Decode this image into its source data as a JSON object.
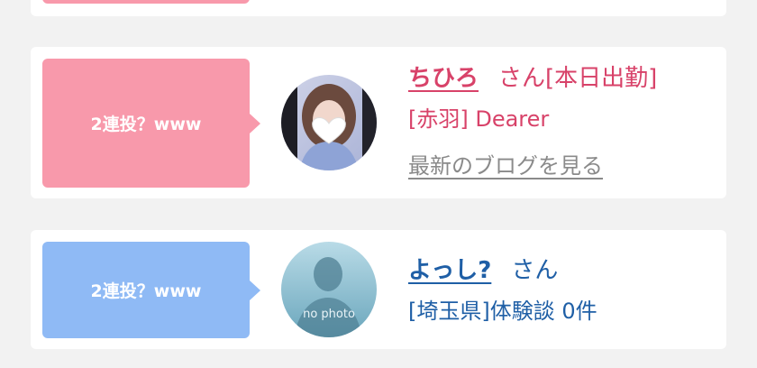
{
  "posts": [
    {
      "badge": "2連投？www",
      "name": "ちひろ",
      "honorific": "さん",
      "status": "[本日出勤]",
      "shop": "[赤羽] Dearer",
      "blog_link": "最新のブログを見る",
      "accent": "#d84269",
      "bubble_color": "#f899ab",
      "avatar_icon": "blurred-portrait-with-heart"
    },
    {
      "badge": "2連投？www",
      "name": "よっし?",
      "honorific": "さん",
      "sub": "[埼玉県]体験談 0件",
      "avatar_text": "no photo",
      "accent": "#1f5fa6",
      "bubble_color": "#8fbaf5",
      "avatar_icon": "silhouette-no-photo"
    }
  ]
}
